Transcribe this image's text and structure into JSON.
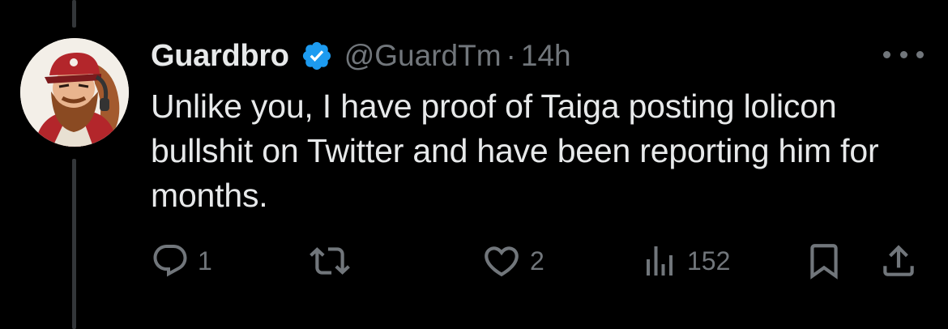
{
  "tweet": {
    "author": {
      "display_name": "Guardbro",
      "handle": "@GuardTm",
      "verified": true
    },
    "separator": "·",
    "time": "14h",
    "text": "Unlike you, I have proof of Taiga posting lolicon bullshit on Twitter and have been reporting him for months.",
    "actions": {
      "reply_count": "1",
      "retweet_count": "",
      "like_count": "2",
      "view_count": "152"
    },
    "icons": {
      "more": "more-dots-icon",
      "verified": "verified-badge-icon",
      "reply": "reply-icon",
      "retweet": "retweet-icon",
      "like": "heart-icon",
      "views": "views-icon",
      "bookmark": "bookmark-icon",
      "share": "share-icon"
    }
  },
  "colors": {
    "background": "#000000",
    "text_primary": "#e7e9ea",
    "text_secondary": "#71767b",
    "verified_blue": "#1d9bf0",
    "thread_line": "#333639"
  }
}
